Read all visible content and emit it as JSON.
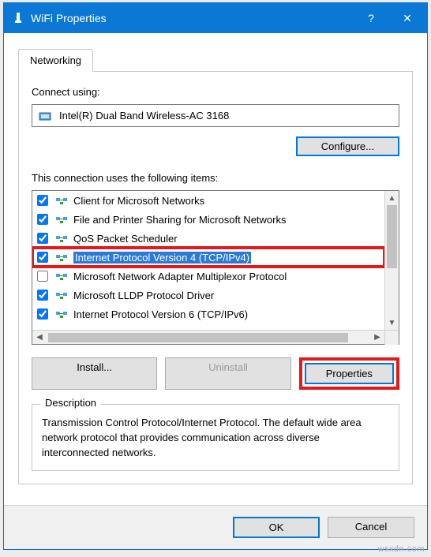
{
  "window": {
    "title": "WiFi Properties",
    "help_label": "?",
    "close_label": "✕"
  },
  "tab": {
    "networking": "Networking"
  },
  "connect_using": {
    "label": "Connect using:",
    "adapter": "Intel(R) Dual Band Wireless-AC 3168"
  },
  "buttons": {
    "configure": "Configure...",
    "install": "Install...",
    "uninstall": "Uninstall",
    "properties": "Properties",
    "ok": "OK",
    "cancel": "Cancel"
  },
  "items_label": "This connection uses the following items:",
  "items": [
    {
      "checked": true,
      "label": "Client for Microsoft Networks",
      "selected": false
    },
    {
      "checked": true,
      "label": "File and Printer Sharing for Microsoft Networks",
      "selected": false
    },
    {
      "checked": true,
      "label": "QoS Packet Scheduler",
      "selected": false
    },
    {
      "checked": true,
      "label": "Internet Protocol Version 4 (TCP/IPv4)",
      "selected": true,
      "highlight": true
    },
    {
      "checked": false,
      "label": "Microsoft Network Adapter Multiplexor Protocol",
      "selected": false
    },
    {
      "checked": true,
      "label": "Microsoft LLDP Protocol Driver",
      "selected": false
    },
    {
      "checked": true,
      "label": "Internet Protocol Version 6 (TCP/IPv6)",
      "selected": false
    }
  ],
  "description": {
    "title": "Description",
    "text": "Transmission Control Protocol/Internet Protocol. The default wide area network protocol that provides communication across diverse interconnected networks."
  },
  "watermark": "wsxdn.com"
}
